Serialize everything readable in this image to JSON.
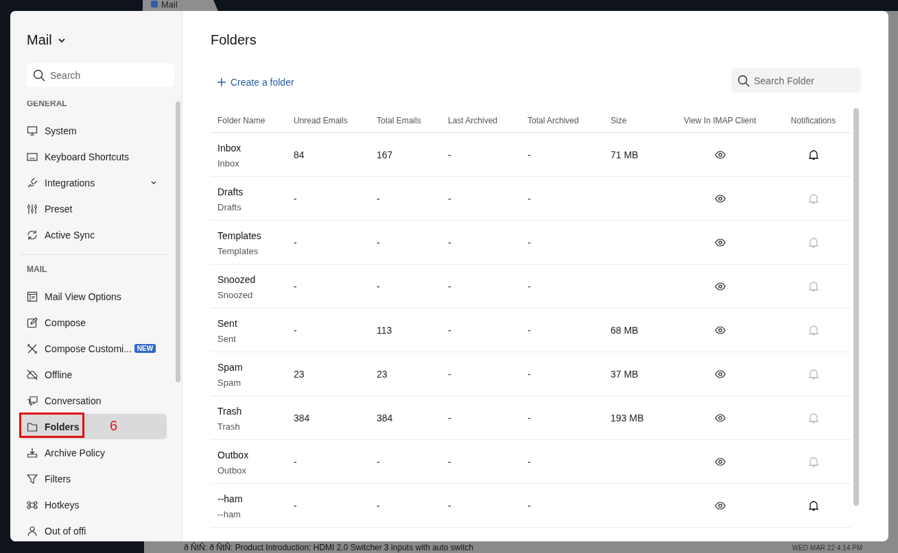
{
  "background": {
    "tab_label": "Mail",
    "email_row": {
      "subject": "ð ÑtÑ: ð ÑtÑ: Product Introduction: HDMI 2.0 Switcher 3 inputs with auto switch",
      "date": "WED MAR 22 4:14 PM"
    }
  },
  "sidebar": {
    "title": "Mail",
    "search": {
      "placeholder": "Search"
    },
    "sections": [
      {
        "heading": "GENERAL",
        "items": [
          {
            "label": "System",
            "selected": false
          },
          {
            "label": "Keyboard Shortcuts",
            "selected": false
          },
          {
            "label": "Integrations",
            "selected": false,
            "expandable": true
          },
          {
            "label": "Preset",
            "selected": false
          },
          {
            "label": "Active Sync",
            "selected": false
          }
        ]
      },
      {
        "heading": "MAIL",
        "items": [
          {
            "label": "Mail View Options",
            "selected": false
          },
          {
            "label": "Compose",
            "selected": false
          },
          {
            "label": "Compose Customi...",
            "selected": false,
            "badge": "NEW"
          },
          {
            "label": "Offline",
            "selected": false
          },
          {
            "label": "Conversation",
            "selected": false
          },
          {
            "label": "Folders",
            "selected": true,
            "annotation": "6"
          },
          {
            "label": "Archive Policy",
            "selected": false
          },
          {
            "label": "Filters",
            "selected": false
          },
          {
            "label": "Hotkeys",
            "selected": false
          },
          {
            "label": "Out of offi",
            "selected": false
          }
        ]
      }
    ]
  },
  "main": {
    "title": "Folders",
    "create_button": "Create a folder",
    "search": {
      "placeholder": "Search Folder"
    },
    "table": {
      "columns": [
        "Folder Name",
        "Unread Emails",
        "Total Emails",
        "Last Archived",
        "Total Archived",
        "Size",
        "View In IMAP Client",
        "Notifications"
      ],
      "rows": [
        {
          "name": "Inbox",
          "sub": "Inbox",
          "unread": "84",
          "total": "167",
          "last_archived": "-",
          "total_archived": "-",
          "size": "71 MB",
          "notifications": true
        },
        {
          "name": "Drafts",
          "sub": "Drafts",
          "unread": "-",
          "total": "-",
          "last_archived": "-",
          "total_archived": "-",
          "notifications": false
        },
        {
          "name": "Templates",
          "sub": "Templates",
          "unread": "-",
          "total": "-",
          "last_archived": "-",
          "total_archived": "-",
          "notifications": false
        },
        {
          "name": "Snoozed",
          "sub": "Snoozed",
          "unread": "-",
          "total": "-",
          "last_archived": "-",
          "total_archived": "-",
          "notifications": false
        },
        {
          "name": "Sent",
          "sub": "Sent",
          "unread": "-",
          "total": "113",
          "last_archived": "-",
          "total_archived": "-",
          "size": "68 MB",
          "notifications": false
        },
        {
          "name": "Spam",
          "sub": "Spam",
          "unread": "23",
          "total": "23",
          "last_archived": "-",
          "total_archived": "-",
          "size": "37 MB",
          "notifications": false
        },
        {
          "name": "Trash",
          "sub": "Trash",
          "unread": "384",
          "total": "384",
          "last_archived": "-",
          "total_archived": "-",
          "size": "193 MB",
          "notifications": false
        },
        {
          "name": "Outbox",
          "sub": "Outbox",
          "unread": "-",
          "total": "-",
          "last_archived": "-",
          "total_archived": "-",
          "notifications": false
        },
        {
          "name": "--ham",
          "sub": "--ham",
          "unread": "-",
          "total": "-",
          "last_archived": "-",
          "total_archived": "-",
          "notifications": true
        }
      ]
    }
  }
}
